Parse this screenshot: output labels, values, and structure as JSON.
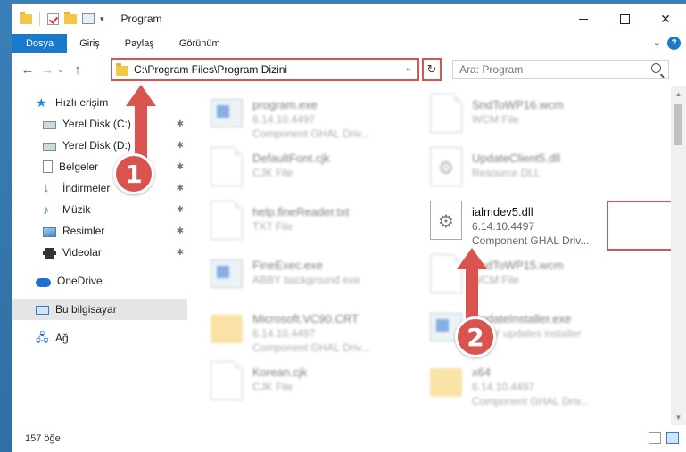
{
  "window": {
    "title": "Program",
    "minimize_label": "",
    "maximize_label": "",
    "close_label": "✕"
  },
  "ribbon": {
    "tabs": [
      "Dosya",
      "Giriş",
      "Paylaş",
      "Görünüm"
    ],
    "help": "?",
    "collapse": "⌄"
  },
  "navigation": {
    "back": "←",
    "forward": "→",
    "recent": "⌄",
    "up": "↑",
    "address": "C:\\Program Files\\Program Dizini",
    "refresh": "↻",
    "search_placeholder": "Ara: Program"
  },
  "sidebar": {
    "quick_access": "Hızlı erişim",
    "pinned": [
      {
        "label": "Yerel Disk (C:)",
        "icon": "disk-icon"
      },
      {
        "label": "Yerel Disk (D:)",
        "icon": "disk-icon"
      },
      {
        "label": "Belgeler",
        "icon": "documents-icon"
      },
      {
        "label": "İndirmeler",
        "icon": "downloads-icon"
      },
      {
        "label": "Müzik",
        "icon": "music-icon"
      },
      {
        "label": "Resimler",
        "icon": "pictures-icon"
      },
      {
        "label": "Videolar",
        "icon": "videos-icon"
      }
    ],
    "onedrive": "OneDrive",
    "this_pc": "Bu bilgisayar",
    "network": "Ağ",
    "pin_glyph": "📌"
  },
  "files": [
    {
      "name": "program.exe",
      "line2": "6.14.10.4497",
      "line3": "Component GHAL Driv...",
      "icon": "exe"
    },
    {
      "name": "SndToWP16.wcm",
      "line2": "WCM File",
      "line3": "",
      "icon": "generic"
    },
    {
      "name": "DefaultFont.cjk",
      "line2": "CJK File",
      "line3": "",
      "icon": "generic"
    },
    {
      "name": "UpdateClient5.dll",
      "line2": "Resource DLL",
      "line3": "",
      "icon": "gear"
    },
    {
      "name": "help.fineReader.txt",
      "line2": "TXT File",
      "line3": "",
      "icon": "generic"
    },
    {
      "name": "ialmdev5.dll",
      "line2": "6.14.10.4497",
      "line3": "Component GHAL Driv...",
      "icon": "gear"
    },
    {
      "name": "FineExec.exe",
      "line2": "ABBY background exe",
      "line3": "",
      "icon": "exe"
    },
    {
      "name": "SndToWP15.wcm",
      "line2": "WCM File",
      "line3": "",
      "icon": "generic"
    },
    {
      "name": "Microsoft.VC90.CRT",
      "line2": "6.14.10.4497",
      "line3": "Component GHAL Driv...",
      "icon": "folder"
    },
    {
      "name": "UpdateInstaller.exe",
      "line2": "ABBY updates installer",
      "line3": "",
      "icon": "exe"
    },
    {
      "name": "Korean.cjk",
      "line2": "CJK File",
      "line3": "",
      "icon": "generic"
    },
    {
      "name": "x64",
      "line2": "6.14.10.4497",
      "line3": "Component GHAL Driv...",
      "icon": "folder"
    }
  ],
  "status": {
    "count": "157 öğe"
  },
  "annotations": {
    "badge1": "1",
    "badge2": "2",
    "color": "#d9534f"
  }
}
